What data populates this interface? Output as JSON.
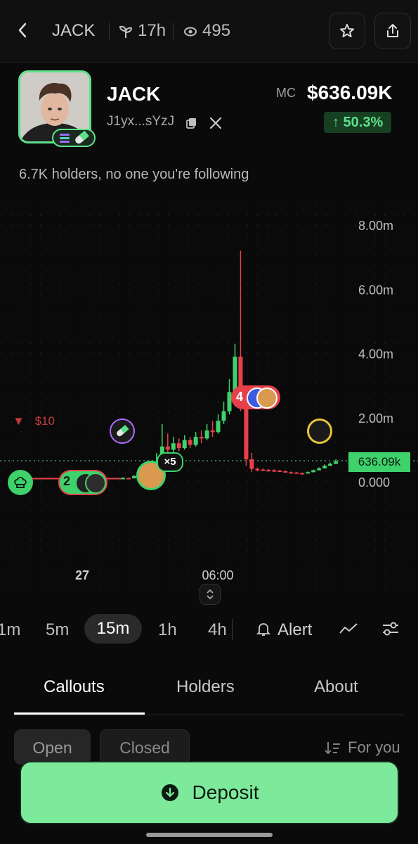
{
  "header": {
    "title": "JACK",
    "age": "17h",
    "views": "495"
  },
  "token": {
    "name": "JACK",
    "address": "J1yx...sYzJ",
    "mc_label": "MC",
    "market_cap": "$636.09K",
    "change": "↑ 50.3%",
    "holders_text": "6.7K holders, no one you're following"
  },
  "chart_data": {
    "type": "candlestick",
    "y_ticks": [
      "8.00m",
      "6.00m",
      "4.00m",
      "2.00m",
      "0.000"
    ],
    "ylim": [
      0,
      8000000
    ],
    "x_ticks": [
      "27",
      "06:00"
    ],
    "current_price_label": "636.09k",
    "alert_label": "$10",
    "markers": [
      {
        "label": "2"
      },
      {
        "label": "×5"
      },
      {
        "label": "4"
      }
    ],
    "candles": [
      {
        "t": 1,
        "o": 100000,
        "c": 120000,
        "h": 140000,
        "l": 90000
      },
      {
        "t": 2,
        "o": 120000,
        "c": 110000,
        "h": 130000,
        "l": 100000
      },
      {
        "t": 3,
        "o": 110000,
        "c": 180000,
        "h": 200000,
        "l": 100000
      },
      {
        "t": 4,
        "o": 180000,
        "c": 250000,
        "h": 280000,
        "l": 170000
      },
      {
        "t": 5,
        "o": 250000,
        "c": 300000,
        "h": 450000,
        "l": 230000
      },
      {
        "t": 6,
        "o": 300000,
        "c": 330000,
        "h": 500000,
        "l": 280000
      },
      {
        "t": 7,
        "o": 330000,
        "c": 600000,
        "h": 900000,
        "l": 300000
      },
      {
        "t": 8,
        "o": 600000,
        "c": 1100000,
        "h": 1800000,
        "l": 550000
      },
      {
        "t": 9,
        "o": 1100000,
        "c": 1000000,
        "h": 1500000,
        "l": 800000
      },
      {
        "t": 10,
        "o": 1000000,
        "c": 1200000,
        "h": 1400000,
        "l": 900000
      },
      {
        "t": 11,
        "o": 1200000,
        "c": 1050000,
        "h": 1350000,
        "l": 950000
      },
      {
        "t": 12,
        "o": 1050000,
        "c": 1300000,
        "h": 1450000,
        "l": 1000000
      },
      {
        "t": 13,
        "o": 1300000,
        "c": 1150000,
        "h": 1400000,
        "l": 1050000
      },
      {
        "t": 14,
        "o": 1150000,
        "c": 1400000,
        "h": 1550000,
        "l": 1100000
      },
      {
        "t": 15,
        "o": 1400000,
        "c": 1350000,
        "h": 1600000,
        "l": 1200000
      },
      {
        "t": 16,
        "o": 1350000,
        "c": 1600000,
        "h": 1800000,
        "l": 1300000
      },
      {
        "t": 17,
        "o": 1600000,
        "c": 1550000,
        "h": 1900000,
        "l": 1400000
      },
      {
        "t": 18,
        "o": 1550000,
        "c": 1900000,
        "h": 2100000,
        "l": 1500000
      },
      {
        "t": 19,
        "o": 1900000,
        "c": 2200000,
        "h": 2500000,
        "l": 1800000
      },
      {
        "t": 20,
        "o": 2200000,
        "c": 2800000,
        "h": 3200000,
        "l": 2100000
      },
      {
        "t": 21,
        "o": 2800000,
        "c": 3900000,
        "h": 4300000,
        "l": 2700000
      },
      {
        "t": 22,
        "o": 3900000,
        "c": 2600000,
        "h": 7200000,
        "l": 2200000
      },
      {
        "t": 23,
        "o": 2600000,
        "c": 700000,
        "h": 2900000,
        "l": 500000
      },
      {
        "t": 24,
        "o": 700000,
        "c": 400000,
        "h": 900000,
        "l": 300000
      },
      {
        "t": 25,
        "o": 400000,
        "c": 380000,
        "h": 450000,
        "l": 330000
      },
      {
        "t": 26,
        "o": 380000,
        "c": 370000,
        "h": 420000,
        "l": 330000
      },
      {
        "t": 27,
        "o": 370000,
        "c": 360000,
        "h": 400000,
        "l": 320000
      },
      {
        "t": 28,
        "o": 360000,
        "c": 350000,
        "h": 390000,
        "l": 310000
      },
      {
        "t": 29,
        "o": 350000,
        "c": 330000,
        "h": 370000,
        "l": 300000
      },
      {
        "t": 30,
        "o": 330000,
        "c": 300000,
        "h": 350000,
        "l": 280000
      },
      {
        "t": 31,
        "o": 300000,
        "c": 290000,
        "h": 320000,
        "l": 260000
      },
      {
        "t": 32,
        "o": 290000,
        "c": 270000,
        "h": 300000,
        "l": 250000
      },
      {
        "t": 33,
        "o": 270000,
        "c": 260000,
        "h": 290000,
        "l": 240000
      },
      {
        "t": 34,
        "o": 260000,
        "c": 300000,
        "h": 320000,
        "l": 250000
      },
      {
        "t": 35,
        "o": 300000,
        "c": 360000,
        "h": 380000,
        "l": 290000
      },
      {
        "t": 36,
        "o": 360000,
        "c": 420000,
        "h": 450000,
        "l": 350000
      },
      {
        "t": 37,
        "o": 420000,
        "c": 500000,
        "h": 540000,
        "l": 410000
      },
      {
        "t": 38,
        "o": 500000,
        "c": 560000,
        "h": 600000,
        "l": 490000
      },
      {
        "t": 39,
        "o": 560000,
        "c": 636090,
        "h": 700000,
        "l": 550000
      }
    ]
  },
  "timeframes": [
    "1m",
    "5m",
    "15m",
    "1h",
    "4h"
  ],
  "active_timeframe": "15m",
  "alert_label": "Alert",
  "tabs": [
    "Callouts",
    "Holders",
    "About"
  ],
  "filters": {
    "open": "Open",
    "closed": "Closed",
    "sort": "For you"
  },
  "deposit_label": "Deposit",
  "colors": {
    "up": "#3fd16b",
    "down": "#e8404a",
    "accent": "#7dea9b"
  }
}
